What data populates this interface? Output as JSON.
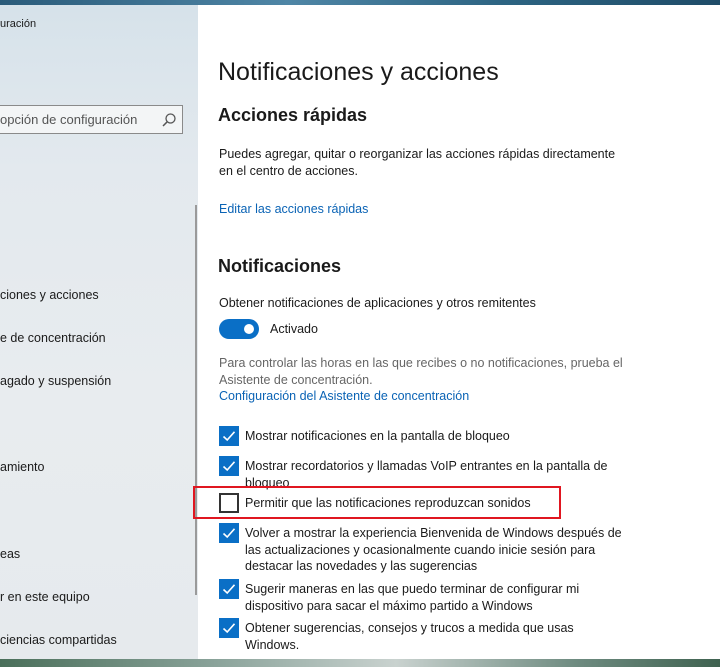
{
  "app": {
    "title": "uración"
  },
  "search": {
    "placeholder": "opción de configuración",
    "icon": "search-icon"
  },
  "sidebar": {
    "items": [
      {
        "label": "ciones y acciones"
      },
      {
        "label": "e de concentración"
      },
      {
        "label": "agado y suspensión"
      },
      {
        "label": "amiento"
      },
      {
        "label": "eas"
      },
      {
        "label": "r en este equipo"
      },
      {
        "label": "ciencias compartidas"
      }
    ]
  },
  "main": {
    "title": "Notificaciones y acciones",
    "quick_actions": {
      "heading": "Acciones rápidas",
      "description": "Puedes agregar, quitar o reorganizar las acciones rápidas directamente en el centro de acciones.",
      "edit_link": "Editar las acciones rápidas"
    },
    "notifications": {
      "heading": "Notificaciones",
      "get_label": "Obtener notificaciones de aplicaciones y otros remitentes",
      "toggle": {
        "state": true,
        "label": "Activado"
      },
      "focus_text": "Para controlar las horas en las que recibes o no notificaciones, prueba el Asistente de concentración.",
      "focus_link": "Configuración del Asistente de concentración",
      "options": [
        {
          "label": "Mostrar notificaciones en la pantalla de bloqueo",
          "checked": true
        },
        {
          "label": "Mostrar recordatorios y llamadas VoIP entrantes en la pantalla de bloqueo",
          "checked": true
        },
        {
          "label": "Permitir que las notificaciones reproduzcan sonidos",
          "checked": false
        },
        {
          "label": "Volver a mostrar la experiencia Bienvenida de Windows después de las actualizaciones y ocasionalmente cuando inicie sesión para destacar las novedades y las sugerencias",
          "checked": true
        },
        {
          "label": "Sugerir maneras en las que puedo terminar de configurar mi dispositivo para sacar el máximo partido a Windows",
          "checked": true
        },
        {
          "label": "Obtener sugerencias, consejos y trucos a medida que usas Windows.",
          "checked": true
        }
      ]
    }
  },
  "colors": {
    "accent": "#0a6fc6",
    "link": "#0a63b5",
    "highlight": "#e01620"
  }
}
